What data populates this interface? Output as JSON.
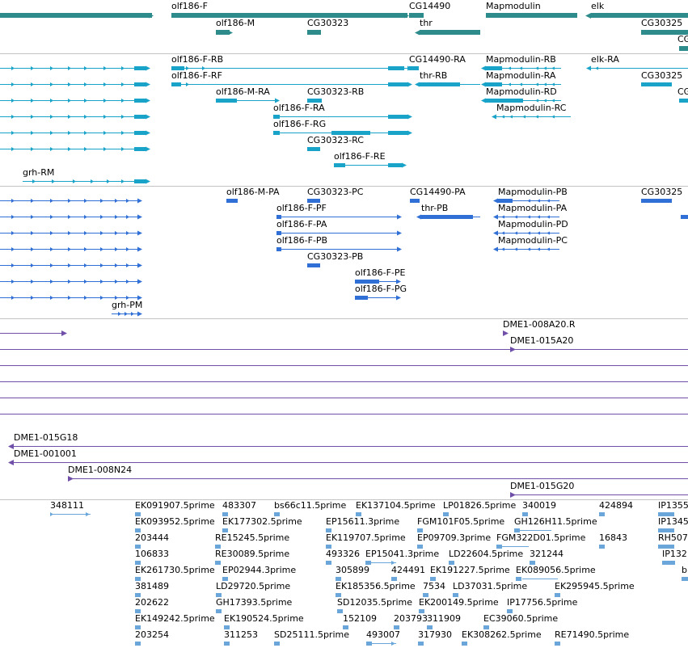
{
  "colors": {
    "genes": "#2e8b8b",
    "transcripts": "#1aa3c9",
    "proteins": "#2f6fd6",
    "clones": "#6f4fa8",
    "ests": "#6aa6d9",
    "separator": "#c4c4c4"
  },
  "tracks": {
    "genes": {
      "labels": [
        "olf186-F",
        "CG14490",
        "Mapmodulin",
        "elk",
        "olf186-M",
        "CG30323",
        "thr",
        "CG30325",
        "CG"
      ]
    },
    "transcripts": {
      "labels": [
        "olf186-F-RB",
        "CG14490-RA",
        "Mapmodulin-RB",
        "elk-RA",
        "olf186-F-RF",
        "thr-RB",
        "Mapmodulin-RA",
        "CG30325",
        "olf186-M-RA",
        "CG30323-RB",
        "Mapmodulin-RD",
        "CG",
        "olf186-F-RA",
        "Mapmodulin-RC",
        "olf186-F-RG",
        "CG30323-RC",
        "olf186-F-RE",
        "grh-RM"
      ]
    },
    "proteins": {
      "labels": [
        "olf186-M-PA",
        "CG30323-PC",
        "CG14490-PA",
        "Mapmodulin-PB",
        "CG30325",
        "olf186-F-PF",
        "thr-PB",
        "Mapmodulin-PA",
        "olf186-F-PA",
        "Mapmodulin-PD",
        "olf186-F-PB",
        "Mapmodulin-PC",
        "CG30323-PB",
        "olf186-F-PE",
        "olf186-F-PG",
        "grh-PM"
      ]
    },
    "clones": {
      "labels": [
        "DME1-008A20.R",
        "DME1-015A20",
        "DME1-015G18",
        "DME1-001001",
        "DME1-008N24",
        "DME1-015G20"
      ]
    },
    "ests": {
      "labels": [
        "348111",
        "EK091907.5prime",
        "483307",
        "bs66c11.5prime",
        "EK137104.5prime",
        "LP01826.5prime",
        "340019",
        "424894",
        "IP1355",
        "EK093952.5prime",
        "EK177302.5prime",
        "EP15611.3prime",
        "FGM101F05.5prime",
        "GH126H11.5prime",
        "IP1345",
        "203444",
        "RE15245.5prime",
        "EK119707.5prime",
        "EP09709.3prime",
        "FGM322D01.5prime",
        "16843",
        "RH507",
        "106833",
        "RE30089.5prime",
        "493326",
        "EP15041.3prime",
        "LD22604.5prime",
        "321244",
        "IP132",
        "EK261730.5prime",
        "EP02944.3prime",
        "305899",
        "424491",
        "EK191227.5prime",
        "EK089056.5prime",
        "b",
        "381489",
        "LD29720.5prime",
        "EK185356.5prime",
        "7534",
        "LD37031.5prime",
        "EK295945.5prime",
        "202622",
        "GH17393.5prime",
        "SD12035.5prime",
        "EK200149.5prime",
        "IP17756.5prime",
        "EK149242.5prime",
        "EK190524.5prime",
        "152109",
        "203793",
        "311909",
        "EC39060.5prime",
        "203254",
        "311253",
        "SD25111.5prime",
        "493007",
        "317930",
        "EK308262.5prime",
        "RE71490.5prime"
      ]
    }
  }
}
